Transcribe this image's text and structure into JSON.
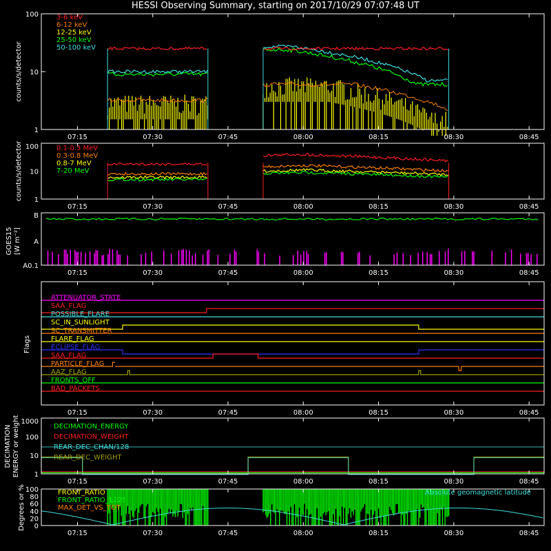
{
  "title": "HESSI Observing Summary, starting on 2017/10/29 07:07:48 UT",
  "time_ticks": [
    "07:15",
    "07:30",
    "07:45",
    "08:00",
    "08:15",
    "08:30",
    "08:45"
  ],
  "colors": {
    "axis": "#ffffff",
    "red": "#ff2020",
    "orange": "#ff8000",
    "yellow": "#ffff00",
    "green": "#00ff00",
    "cyan": "#40e0e0",
    "magenta": "#ff00ff",
    "blue": "#3030ff",
    "olive": "#a0a000",
    "teal": "#30a0a0"
  },
  "panel1": {
    "ylabel": "counts/s/detector",
    "yticks": [
      "100",
      "10",
      "1"
    ],
    "legend": [
      "3-6 keV",
      "6-12 keV",
      "12-25 keV",
      "25-50 keV",
      "50-100 keV"
    ]
  },
  "panel2": {
    "ylabel": "counts/s/detector",
    "yticks": [
      "100",
      "10",
      "1"
    ],
    "legend": [
      "0.1-0.3 MeV",
      "0.3-0.8 MeV",
      "0.8-7 MeV",
      "7-20 MeV"
    ]
  },
  "panel3": {
    "ylabel1": "GOES15",
    "ylabel2": "[W m⁻²]",
    "yticks": [
      "B",
      "A",
      "A0.1"
    ]
  },
  "panel4": {
    "ylabel": "Flags",
    "flags": [
      "ATTENUATOR_STATE",
      "SAA_FLAG",
      "POSSIBLE_FLARE",
      "SC_IN_SUNLIGHT",
      "SC_TRANSMITTER",
      "FLARE_FLAG",
      "ECLIPSE_FLAG",
      "SAA_FLAG",
      "PARTICLE_FLAG",
      "AAZ_FLAG",
      "FRONTS_OFF",
      "BAD_PACKETS"
    ]
  },
  "panel5": {
    "ylabel1": "DECIMATION",
    "ylabel2": "ENERGY or weight",
    "yticks": [
      "1000",
      "100",
      "10",
      "1"
    ],
    "legend": [
      "DECIMATION_ENERGY",
      "DECIMATION_WEIGHT",
      "REAR_DEC_CHAN/128",
      "REAR_DEC_WEIGHT"
    ]
  },
  "panel6": {
    "ylabel": "Degrees or %",
    "yticks": [
      "100",
      "80",
      "60",
      "40",
      "20",
      "0"
    ],
    "legend": [
      "FRONT_RATIO",
      "FRONT_RATIO_1225",
      "MAX_DET_VS_TOT"
    ],
    "right_label": "Absolute geomagnetic latitude"
  },
  "chart_data": [
    {
      "type": "line",
      "title": "HESSI Observing Summary, starting on 2017/10/29 07:07:48 UT",
      "ylabel": "counts/s/detector",
      "yscale": "log",
      "ylim": [
        1,
        100
      ],
      "x_range": [
        "07:07:48",
        "08:48"
      ],
      "data_intervals": [
        [
          "07:21",
          "07:41"
        ],
        [
          "07:52",
          "08:29"
        ]
      ],
      "series": [
        {
          "name": "3-6 keV",
          "level": [
            25,
            25
          ]
        },
        {
          "name": "6-12 keV",
          "level": [
            3,
            3
          ]
        },
        {
          "name": "12-25 keV",
          "level": [
            2,
            2
          ]
        },
        {
          "name": "25-50 keV",
          "level": [
            8,
            25
          ]
        },
        {
          "name": "50-100 keV",
          "level": [
            9,
            25
          ]
        }
      ]
    },
    {
      "type": "line",
      "ylabel": "counts/s/detector",
      "yscale": "log",
      "ylim": [
        1,
        100
      ],
      "series": [
        {
          "name": "0.1-0.3 MeV",
          "level": [
            18,
            40
          ]
        },
        {
          "name": "0.3-0.8 MeV",
          "level": [
            8,
            18
          ]
        },
        {
          "name": "0.8-7 MeV",
          "level": [
            6,
            12
          ]
        },
        {
          "name": "7-20 MeV",
          "level": [
            5,
            10
          ]
        }
      ]
    },
    {
      "type": "line",
      "ylabel": "GOES15 [W m⁻²]",
      "yticks": [
        "B",
        "A",
        "A0.1"
      ]
    },
    {
      "type": "line",
      "ylabel": "Flags"
    },
    {
      "type": "line",
      "ylabel": "DECIMATION ENERGY or weight",
      "yscale": "log",
      "ylim": [
        1,
        1000
      ]
    },
    {
      "type": "line",
      "ylabel": "Degrees or %",
      "ylim": [
        0,
        100
      ]
    }
  ]
}
